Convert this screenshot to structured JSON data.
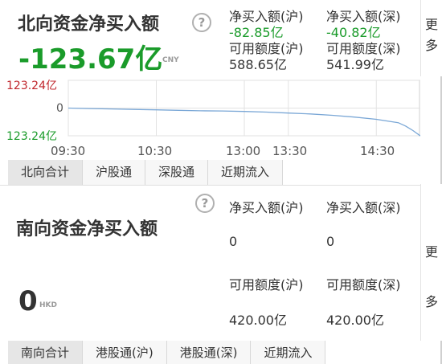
{
  "north": {
    "title": "北向资金净买入额",
    "help": "?",
    "value": "-123.67亿",
    "currency": "CNY",
    "stats": {
      "sh_net_label": "净买入额(沪)",
      "sh_net_value": "-82.85亿",
      "sz_net_label": "净买入额(深)",
      "sz_net_value": "-40.82亿",
      "sh_quota_label": "可用额度(沪)",
      "sh_quota_value": "588.65亿",
      "sz_quota_label": "可用额度(深)",
      "sz_quota_value": "541.99亿"
    },
    "more": "更多",
    "tabs": [
      "北向合计",
      "沪股通",
      "深股通",
      "近期流入"
    ],
    "active_tab": 0
  },
  "chart_data": {
    "type": "line",
    "title": "",
    "xlabel": "",
    "ylabel": "",
    "y_tick_labels": [
      "123.24亿",
      "0",
      "123.24亿"
    ],
    "x_tick_labels": [
      "09:30",
      "10:30",
      "13:00",
      "13:30",
      "14:30"
    ],
    "ylim": [
      -123.24,
      123.24
    ],
    "grid": true,
    "series": [
      {
        "color": "#7aa7d6",
        "x": [
          "09:30",
          "09:45",
          "10:00",
          "10:15",
          "10:30",
          "10:45",
          "11:00",
          "11:15",
          "11:30",
          "13:15",
          "13:30",
          "13:45",
          "14:00",
          "14:15",
          "14:30",
          "14:45",
          "14:50",
          "14:55",
          "15:00"
        ],
        "values": [
          0,
          -2,
          -4,
          -6,
          -8,
          -10,
          -12,
          -13,
          -15,
          -18,
          -22,
          -26,
          -32,
          -40,
          -50,
          -65,
          -80,
          -100,
          -123.67
        ]
      }
    ]
  },
  "south": {
    "title": "南向资金净买入额",
    "help": "?",
    "value": "0",
    "currency": "HKD",
    "stats": {
      "sh_net_label": "净买入额(沪)",
      "sh_net_value": "0",
      "sz_net_label": "净买入额(深)",
      "sz_net_value": "0",
      "sh_quota_label": "可用额度(沪)",
      "sh_quota_value": "420.00亿",
      "sz_quota_label": "可用额度(深)",
      "sz_quota_value": "420.00亿"
    },
    "more": "更多",
    "tabs": [
      "南向合计",
      "港股通(沪)",
      "港股通(深)",
      "近期流入"
    ],
    "active_tab": 0
  }
}
